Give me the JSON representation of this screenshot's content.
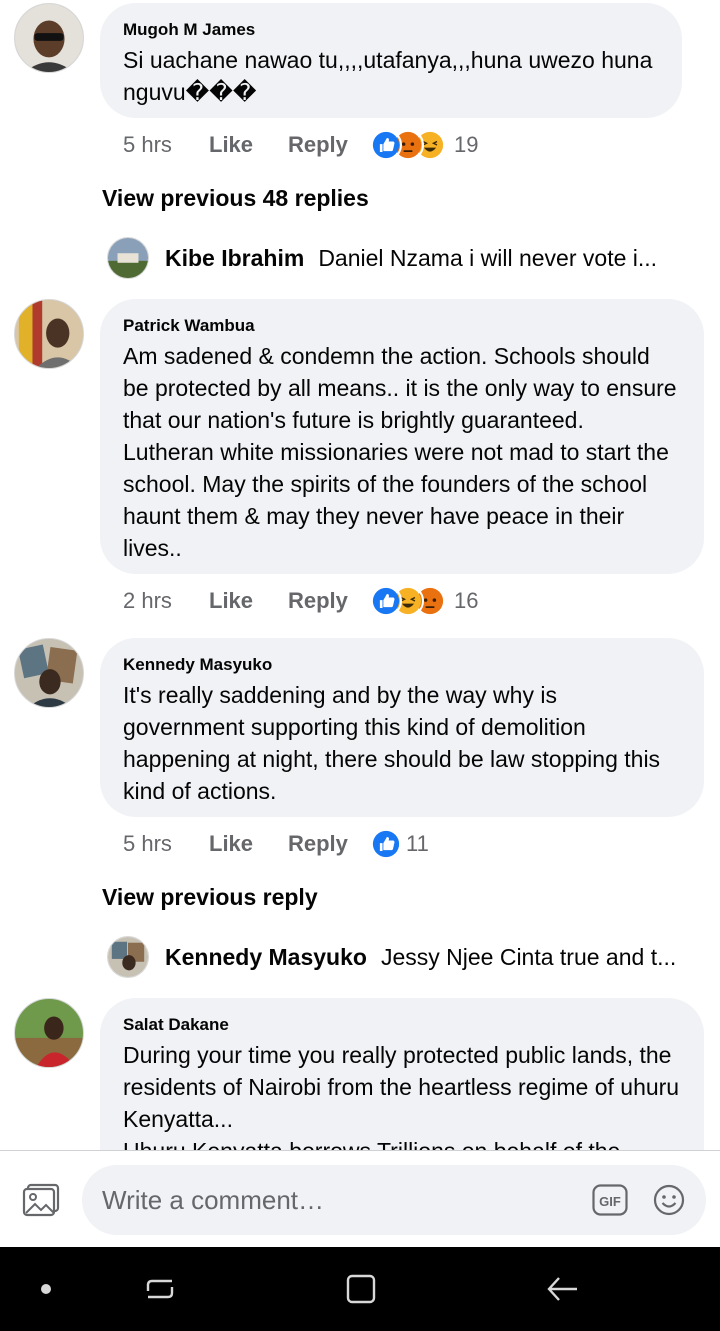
{
  "comments": [
    {
      "author": "Mugoh M James",
      "text": "Si uachane nawao tu,,,,utafanya,,,huna uwezo huna nguvu���",
      "time": "5 hrs",
      "like_label": "Like",
      "reply_label": "Reply",
      "reaction_count": "19"
    },
    {
      "author": "Patrick Wambua",
      "text": "Am sadened & condemn the action. Schools should be protected by all means.. it is the only way to ensure that our nation's future is brightly guaranteed. Lutheran white missionaries were not mad to start the school. May the spirits of the founders of the school haunt them & may they never have peace in their lives..",
      "time": "2 hrs",
      "like_label": "Like",
      "reply_label": "Reply",
      "reaction_count": "16"
    },
    {
      "author": "Kennedy Masyuko",
      "text": "It's really saddening and by the way why is government supporting this kind of demolition happening at night, there should be law stopping this kind of actions.",
      "time": "5 hrs",
      "like_label": "Like",
      "reply_label": "Reply",
      "reaction_count": "11"
    },
    {
      "author": "Salat Dakane",
      "text": "During your time you really protected public lands, the residents of Nairobi from the heartless regime of uhuru Kenyatta...\n Uhuru Kenyatta borrows Trillions on behalf of the"
    }
  ],
  "view_previous": [
    {
      "label": "View previous 48 replies"
    },
    {
      "label": "View previous reply"
    }
  ],
  "reply_previews": [
    {
      "name": "Kibe Ibrahim",
      "text": "Daniel Nzama i will  never vote i..."
    },
    {
      "name": "Kennedy Masyuko",
      "text": "Jessy Njee Cinta true and t..."
    }
  ],
  "composer": {
    "placeholder": "Write a comment…",
    "gif_label": "GIF"
  },
  "colors": {
    "bubble": "#f0f2f5",
    "like_blue": "#1877f2",
    "angry": "#e9710f",
    "haha": "#f7b125",
    "secondary_text": "#65676b"
  },
  "icons": [
    "photo-icon",
    "gif-icon",
    "emoji-icon",
    "like-reaction-icon",
    "angry-reaction-icon",
    "haha-reaction-icon",
    "nav-dot-icon",
    "recents-icon",
    "home-icon",
    "back-icon"
  ]
}
